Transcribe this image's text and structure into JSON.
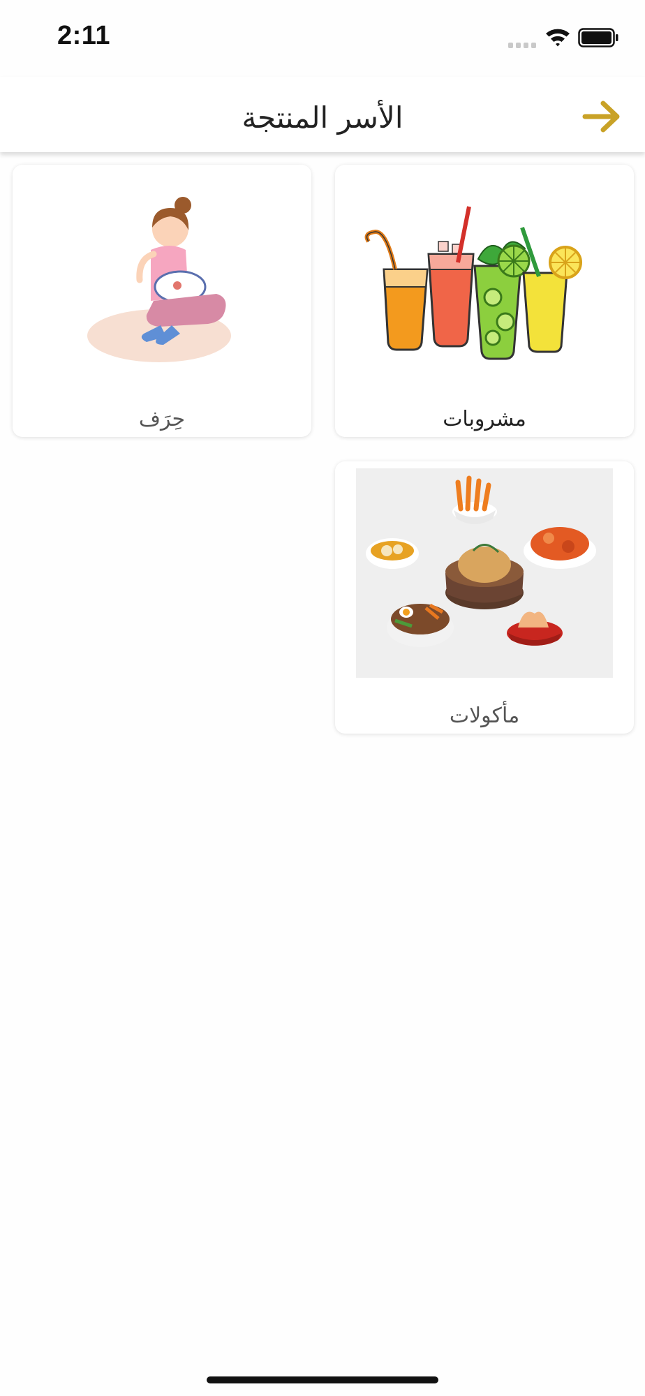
{
  "status_bar": {
    "time": "2:11",
    "signal_icon": "signal-icon",
    "wifi_icon": "wifi-icon",
    "battery_icon": "battery-icon"
  },
  "header": {
    "title": "الأسر المنتجة",
    "back_icon": "arrow-right-icon",
    "accent_color": "#c9a227"
  },
  "categories": [
    {
      "label": "مشروبات",
      "image": "juice-drinks-illustration"
    },
    {
      "label": "حِرَف",
      "image": "woman-embroidering-illustration"
    },
    {
      "label": "مأكولات",
      "image": "food-dishes-illustration"
    }
  ]
}
